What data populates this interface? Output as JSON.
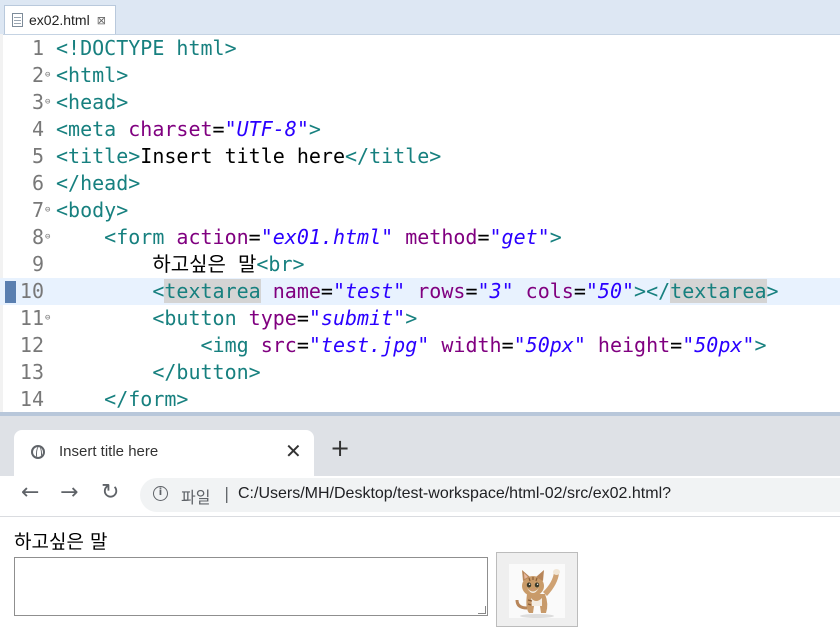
{
  "editor": {
    "tab_label": "ex02.html",
    "tab_close": "⊠",
    "lines": [
      {
        "num": "1",
        "fold": "",
        "segs": [
          [
            "teal",
            "<!DOCTYPE html>"
          ]
        ]
      },
      {
        "num": "2",
        "fold": "⊖",
        "segs": [
          [
            "teal",
            "<html>"
          ]
        ]
      },
      {
        "num": "3",
        "fold": "⊖",
        "segs": [
          [
            "teal",
            "<head>"
          ]
        ]
      },
      {
        "num": "4",
        "fold": "",
        "segs": [
          [
            "teal",
            "<meta "
          ],
          [
            "purple",
            "charset"
          ],
          [
            "black",
            "="
          ],
          [
            "blue",
            "\"UTF-8\""
          ],
          [
            "teal",
            ">"
          ]
        ]
      },
      {
        "num": "5",
        "fold": "",
        "segs": [
          [
            "teal",
            "<title>"
          ],
          [
            "black",
            "Insert title here"
          ],
          [
            "teal",
            "</title>"
          ]
        ]
      },
      {
        "num": "6",
        "fold": "",
        "segs": [
          [
            "teal",
            "</head>"
          ]
        ]
      },
      {
        "num": "7",
        "fold": "⊖",
        "segs": [
          [
            "teal",
            "<body>"
          ]
        ]
      },
      {
        "num": "8",
        "fold": "⊖",
        "segs": [
          [
            "black",
            "    "
          ],
          [
            "teal",
            "<form "
          ],
          [
            "purple",
            "action"
          ],
          [
            "black",
            "="
          ],
          [
            "blue",
            "\"ex01.html\""
          ],
          [
            "black",
            " "
          ],
          [
            "purple",
            "method"
          ],
          [
            "black",
            "="
          ],
          [
            "blue",
            "\"get\""
          ],
          [
            "teal",
            ">"
          ]
        ]
      },
      {
        "num": "9",
        "fold": "",
        "segs": [
          [
            "black",
            "        하고싶은 말"
          ],
          [
            "teal",
            "<br>"
          ]
        ]
      },
      {
        "num": "10",
        "fold": "",
        "current": true,
        "segs": [
          [
            "black",
            "        "
          ],
          [
            "teal",
            "<"
          ],
          [
            "teal-hl",
            "textarea"
          ],
          [
            "black",
            " "
          ],
          [
            "purple",
            "name"
          ],
          [
            "black",
            "="
          ],
          [
            "blue",
            "\"test\""
          ],
          [
            "black",
            " "
          ],
          [
            "purple",
            "rows"
          ],
          [
            "black",
            "="
          ],
          [
            "blue",
            "\"3\""
          ],
          [
            "black",
            " "
          ],
          [
            "purple",
            "cols"
          ],
          [
            "black",
            "="
          ],
          [
            "blue",
            "\"50\""
          ],
          [
            "teal",
            "></"
          ],
          [
            "teal-hl",
            "textarea"
          ],
          [
            "teal",
            ">"
          ]
        ]
      },
      {
        "num": "11",
        "fold": "⊖",
        "segs": [
          [
            "black",
            "        "
          ],
          [
            "teal",
            "<button "
          ],
          [
            "purple",
            "type"
          ],
          [
            "black",
            "="
          ],
          [
            "blue",
            "\"submit\""
          ],
          [
            "teal",
            ">"
          ]
        ]
      },
      {
        "num": "12",
        "fold": "",
        "segs": [
          [
            "black",
            "            "
          ],
          [
            "teal",
            "<img "
          ],
          [
            "purple",
            "src"
          ],
          [
            "black",
            "="
          ],
          [
            "blue",
            "\"test.jpg\""
          ],
          [
            "black",
            " "
          ],
          [
            "purple",
            "width"
          ],
          [
            "black",
            "="
          ],
          [
            "blue",
            "\"50px\""
          ],
          [
            "black",
            " "
          ],
          [
            "purple",
            "height"
          ],
          [
            "black",
            "="
          ],
          [
            "blue",
            "\"50px\""
          ],
          [
            "teal",
            ">"
          ]
        ]
      },
      {
        "num": "13",
        "fold": "",
        "segs": [
          [
            "black",
            "        "
          ],
          [
            "teal",
            "</button>"
          ]
        ]
      },
      {
        "num": "14",
        "fold": "",
        "segs": [
          [
            "black",
            "    "
          ],
          [
            "teal",
            "</form>"
          ]
        ]
      }
    ]
  },
  "browser": {
    "tab_title": "Insert title here",
    "tab_close": "✕",
    "new_tab": "+",
    "back": "←",
    "forward": "→",
    "reload": "↻",
    "info_icon": "i",
    "scheme": "파일",
    "separator": "|",
    "url": "C:/Users/MH/Desktop/test-workspace/html-02/src/ex02.html?"
  },
  "page": {
    "label": "하고싶은 말",
    "textarea_value": ""
  },
  "colors": {
    "tag": "#17807f",
    "attribute": "#800080",
    "value": "#2a00ff",
    "current_line": "#e8f2fe"
  }
}
